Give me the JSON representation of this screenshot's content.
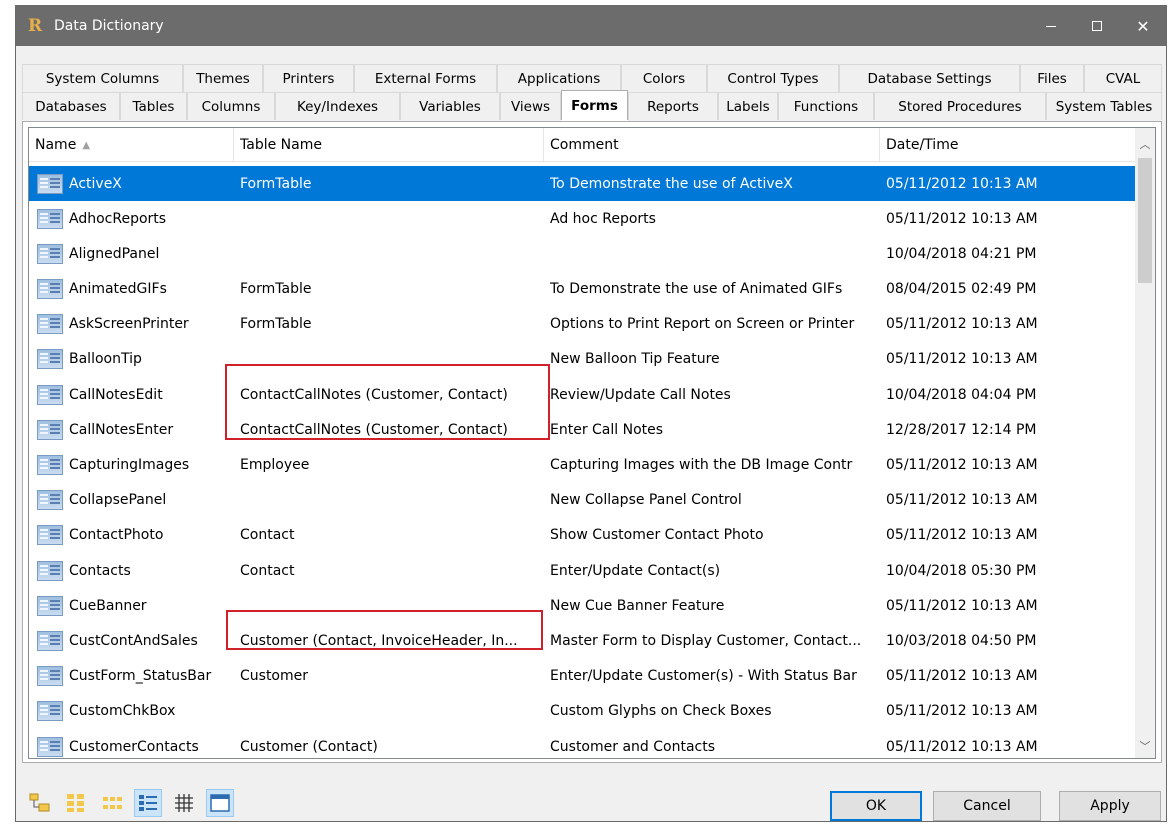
{
  "window": {
    "title": "Data Dictionary"
  },
  "tabs": {
    "row1": [
      "System Columns",
      "Themes",
      "Printers",
      "External Forms",
      "Applications",
      "Colors",
      "Control Types",
      "Database Settings",
      "Files",
      "CVAL"
    ],
    "row2": [
      "Databases",
      "Tables",
      "Columns",
      "Key/Indexes",
      "Variables",
      "Views",
      "Forms",
      "Reports",
      "Labels",
      "Functions",
      "Stored Procedures",
      "System Tables"
    ],
    "active": "Forms"
  },
  "list": {
    "columns": [
      "Name",
      "Table Name",
      "Comment",
      "Date/Time"
    ],
    "sort_column": "Name",
    "rows": [
      {
        "name": "ActiveX",
        "table": "FormTable",
        "comment": "To Demonstrate the use of ActiveX",
        "date": "05/11/2012 10:13 AM",
        "selected": true
      },
      {
        "name": "AdhocReports",
        "table": "",
        "comment": "Ad hoc Reports",
        "date": "05/11/2012 10:13 AM"
      },
      {
        "name": "AlignedPanel",
        "table": "",
        "comment": "",
        "date": "10/04/2018 04:21 PM"
      },
      {
        "name": "AnimatedGIFs",
        "table": "FormTable",
        "comment": "To Demonstrate the use of Animated GIFs",
        "date": "08/04/2015 02:49 PM"
      },
      {
        "name": "AskScreenPrinter",
        "table": "FormTable",
        "comment": "Options to Print Report on Screen or Printer",
        "date": "05/11/2012 10:13 AM"
      },
      {
        "name": "BalloonTip",
        "table": "",
        "comment": "New Balloon Tip Feature",
        "date": "05/11/2012 10:13 AM"
      },
      {
        "name": "CallNotesEdit",
        "table": "ContactCallNotes (Customer, Contact)",
        "comment": "Review/Update Call Notes",
        "date": "10/04/2018 04:04 PM"
      },
      {
        "name": "CallNotesEnter",
        "table": "ContactCallNotes (Customer, Contact)",
        "comment": "Enter Call Notes",
        "date": "12/28/2017 12:14 PM"
      },
      {
        "name": "CapturingImages",
        "table": "Employee",
        "comment": "Capturing Images with the DB Image Contr",
        "date": "05/11/2012 10:13 AM"
      },
      {
        "name": "CollapsePanel",
        "table": "",
        "comment": "New Collapse Panel Control",
        "date": "05/11/2012 10:13 AM"
      },
      {
        "name": "ContactPhoto",
        "table": "Contact",
        "comment": "Show Customer Contact Photo",
        "date": "05/11/2012 10:13 AM"
      },
      {
        "name": "Contacts",
        "table": "Contact",
        "comment": "Enter/Update Contact(s)",
        "date": "10/04/2018 05:30 PM"
      },
      {
        "name": "CueBanner",
        "table": "",
        "comment": "New Cue Banner Feature",
        "date": "05/11/2012 10:13 AM"
      },
      {
        "name": "CustContAndSales",
        "table": "Customer (Contact, InvoiceHeader, In...",
        "comment": "Master Form to Display Customer, Contact...",
        "date": "10/03/2018 04:50 PM"
      },
      {
        "name": "CustForm_StatusBar",
        "table": "Customer",
        "comment": "Enter/Update Customer(s) - With Status Bar",
        "date": "05/11/2012 10:13 AM"
      },
      {
        "name": "CustomChkBox",
        "table": "",
        "comment": "Custom Glyphs on Check Boxes",
        "date": "05/11/2012 10:13 AM"
      },
      {
        "name": "CustomerContacts",
        "table": "Customer (Contact)",
        "comment": "Customer and Contacts",
        "date": "05/11/2012 10:13 AM"
      }
    ]
  },
  "buttons": {
    "ok": "OK",
    "cancel": "Cancel",
    "apply": "Apply"
  },
  "colors": {
    "selection": "#0078d7",
    "highlight_box": "#d0202a",
    "titlebar": "#6c6c6c"
  }
}
